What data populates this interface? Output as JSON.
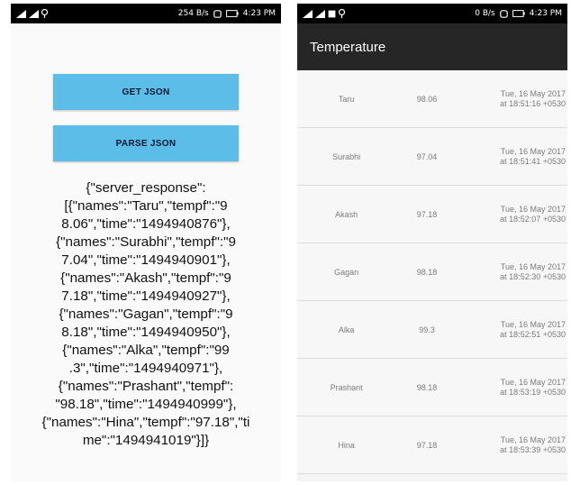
{
  "left": {
    "status": {
      "speed": "254 B/s",
      "battery_time": "4:23 PM"
    },
    "buttons": {
      "get_json": "GET JSON",
      "parse_json": "PARSE JSON"
    },
    "json_lines": [
      "{\"server_response\":",
      "[{\"names\":\"Taru\",\"tempf\":\"9",
      "8.06\",\"time\":\"1494940876\"},",
      "{\"names\":\"Surabhi\",\"tempf\":\"9",
      "7.04\",\"time\":\"1494940901\"},",
      "{\"names\":\"Akash\",\"tempf\":\"9",
      "7.18\",\"time\":\"1494940927\"},",
      "{\"names\":\"Gagan\",\"tempf\":\"9",
      "8.18\",\"time\":\"1494940950\"},",
      "{\"names\":\"Alka\",\"tempf\":\"99",
      ".3\",\"time\":\"1494940971\"},",
      "{\"names\":\"Prashant\",\"tempf\":",
      "\"98.18\",\"time\":\"1494940999\"},",
      "{\"names\":\"Hina\",\"tempf\":\"97.18\",\"ti",
      "me\":\"1494941019\"}]}"
    ]
  },
  "right": {
    "status": {
      "speed": "0 B/s",
      "battery_time": "4:23 PM"
    },
    "title": "Temperature",
    "rows": [
      {
        "name": "Taru",
        "temp": "98.06",
        "date": "Tue, 16 May 2017",
        "time": "at 18:51:16 +0530"
      },
      {
        "name": "Surabhi",
        "temp": "97.04",
        "date": "Tue, 16 May 2017",
        "time": "at 18:51:41 +0530"
      },
      {
        "name": "Akash",
        "temp": "97.18",
        "date": "Tue, 16 May 2017",
        "time": "at 18:52:07 +0530"
      },
      {
        "name": "Gagan",
        "temp": "98.18",
        "date": "Tue, 16 May 2017",
        "time": "at 18:52:30 +0530"
      },
      {
        "name": "Alka",
        "temp": "99.3",
        "date": "Tue, 16 May 2017",
        "time": "at 18:52:51 +0530"
      },
      {
        "name": "Prashant",
        "temp": "98.18",
        "date": "Tue, 16 May 2017",
        "time": "at 18:53:19 +0530"
      },
      {
        "name": "Hina",
        "temp": "97.18",
        "date": "Tue, 16 May 2017",
        "time": "at 18:53:39 +0530"
      }
    ]
  },
  "colors": {
    "button": "#5bbde8",
    "appbar": "#262626",
    "statusbar": "#000000"
  },
  "icons": [
    "signal-icon",
    "location-icon",
    "image-icon",
    "alarm-icon",
    "battery-icon"
  ]
}
